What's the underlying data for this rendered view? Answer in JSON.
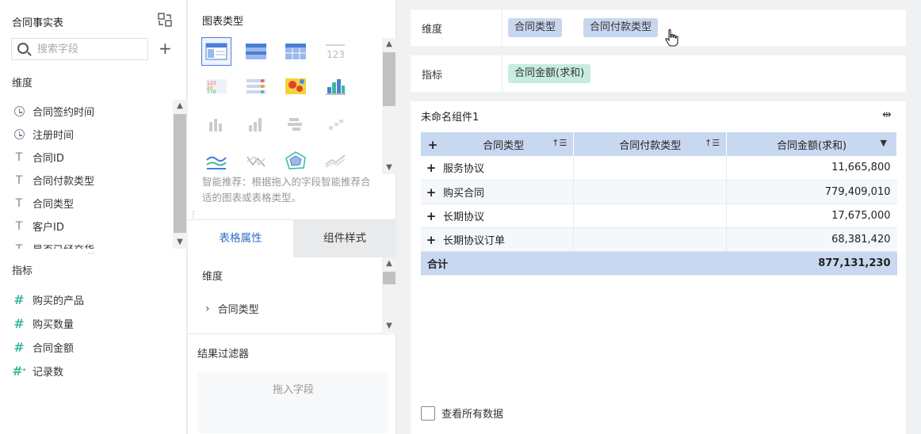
{
  "left": {
    "title": "合同事实表",
    "search_placeholder": "搜索字段",
    "dimension_label": "维度",
    "dimensions": [
      {
        "icon": "clock-icon",
        "label": "合同签约时间"
      },
      {
        "icon": "clock-icon",
        "label": "注册时间"
      },
      {
        "icon": "text-icon",
        "label": "合同ID"
      },
      {
        "icon": "text-icon",
        "label": "合同付款类型"
      },
      {
        "icon": "text-icon",
        "label": "合同类型"
      },
      {
        "icon": "text-icon",
        "label": "客户ID"
      },
      {
        "icon": "text-icon",
        "label": "是否已经交货"
      }
    ],
    "measure_label": "指标",
    "measures": [
      {
        "icon": "hash-icon",
        "label": "购买的产品"
      },
      {
        "icon": "hash-icon",
        "label": "购买数量"
      },
      {
        "icon": "hash-icon",
        "label": "合同金额"
      },
      {
        "icon": "record-count-icon",
        "label": "记录数"
      }
    ]
  },
  "mid": {
    "title": "图表类型",
    "hint": "智能推荐：根据拖入的字段智能推荐合适的图表或表格类型。",
    "tab_table_props": "表格属性",
    "tab_component_style": "组件样式",
    "dimension_label": "维度",
    "dimension_item": "合同类型",
    "filter_label": "结果过滤器",
    "drop_placeholder": "拖入字段",
    "chart_types": [
      "grouped-table",
      "cross-table",
      "detail-table",
      "kpi-card",
      "text-compare",
      "list-bars",
      "heatmap",
      "histogram",
      "bar-chart",
      "column-chart",
      "waterfall",
      "small-bars",
      "line-chart",
      "radar-line",
      "radar-chart",
      "area-chart"
    ]
  },
  "right": {
    "dimension_label": "维度",
    "dimension_pills": [
      "合同类型",
      "合同付款类型"
    ],
    "measure_label": "指标",
    "measure_pills": [
      "合同金额(求和)"
    ],
    "component_title": "未命名组件1",
    "table": {
      "headers": [
        "合同类型",
        "合同付款类型",
        "合同金额(求和)"
      ],
      "rows": [
        {
          "type": "服务协议",
          "amount": "11,665,800"
        },
        {
          "type": "购买合同",
          "amount": "779,409,010"
        },
        {
          "type": "长期协议",
          "amount": "17,675,000"
        },
        {
          "type": "长期协议订单",
          "amount": "68,381,420"
        }
      ],
      "total_label": "合计",
      "total_value": "877,131,230"
    },
    "view_all_label": "查看所有数据"
  },
  "colors": {
    "accent": "#2f6fc6",
    "dim_pill": "#c8d6ef",
    "measure_pill": "#c7ece2",
    "header_bg": "#c8d8f0",
    "measure_icon": "#3cb89f"
  }
}
